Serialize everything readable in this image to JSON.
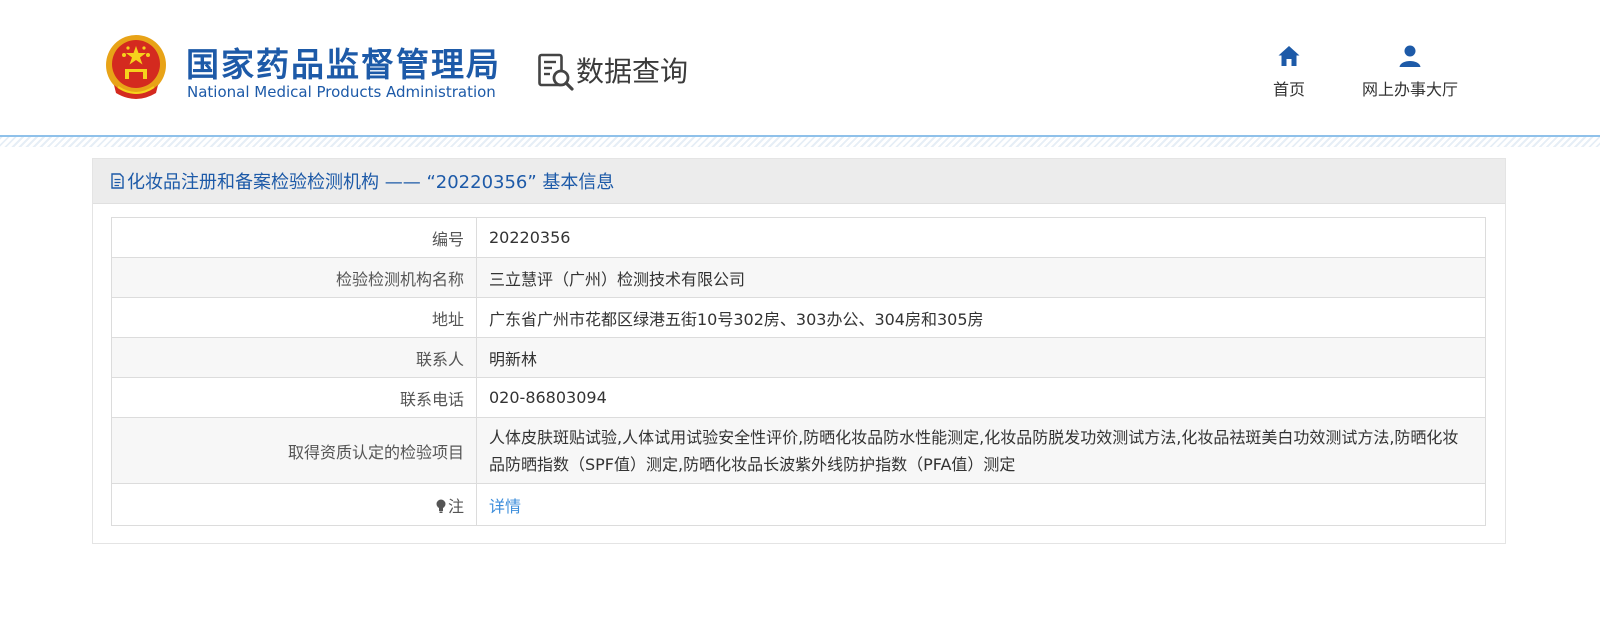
{
  "header": {
    "agency_name_cn": "国家药品监督管理局",
    "agency_name_en": "National Medical Products Administration",
    "query_title": "数据查询",
    "logo_icon": "national-emblem-icon",
    "query_icon": "document-search-icon",
    "nav": [
      {
        "label": "首页",
        "icon": "home-icon"
      },
      {
        "label": "网上办事大厅",
        "icon": "user-icon"
      }
    ]
  },
  "panel": {
    "title": "化妆品注册和备案检验检测机构 —— “20220356” 基本信息",
    "title_icon": "document-icon"
  },
  "details": {
    "number": {
      "label": "编号",
      "value": "20220356"
    },
    "org_name": {
      "label": "检验检测机构名称",
      "value": "三立慧评（广州）检测技术有限公司"
    },
    "address": {
      "label": "地址",
      "value": "广东省广州市花都区绿港五街10号302房、303办公、304房和305房"
    },
    "contact": {
      "label": "联系人",
      "value": "明新林"
    },
    "phone": {
      "label": "联系电话",
      "value": "020-86803094"
    },
    "items": {
      "label": "取得资质认定的检验项目",
      "value": "人体皮肤斑贴试验,人体试用试验安全性评价,防晒化妆品防水性能测定,化妆品防脱发功效测试方法,化妆品祛斑美白功效测试方法,防晒化妆品防晒指数（SPF值）测定,防晒化妆品长波紫外线防护指数（PFA值）测定"
    },
    "note": {
      "label": "注",
      "link": "详情",
      "icon": "lightbulb-icon"
    }
  },
  "colors": {
    "brand_blue": "#1d5aa8",
    "link_blue": "#3c8ddb",
    "header_bg": "#ececec",
    "row_alt": "#f7f7f7"
  }
}
